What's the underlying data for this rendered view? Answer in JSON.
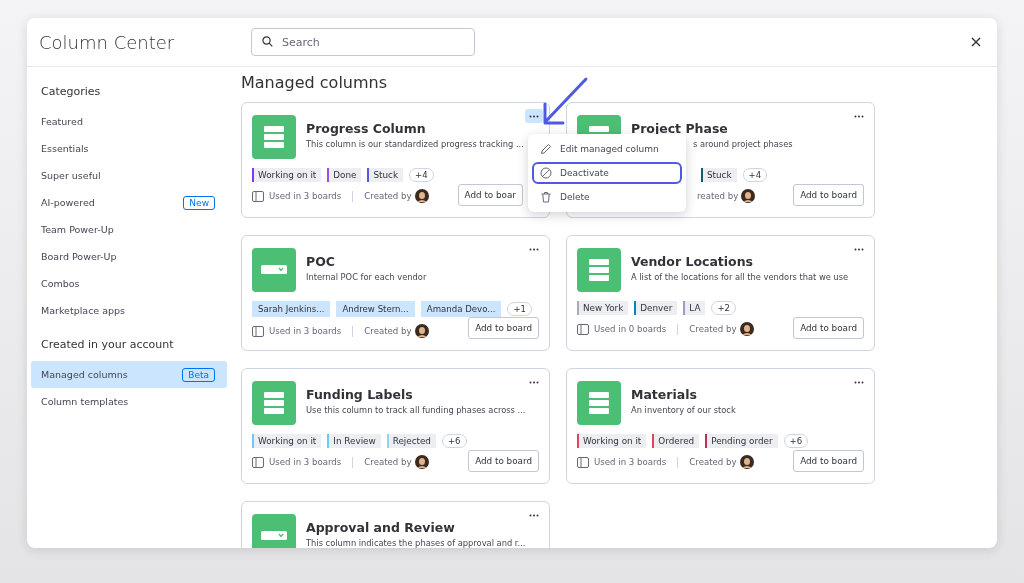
{
  "window": {
    "title": "Column Center"
  },
  "search": {
    "placeholder": "Search"
  },
  "sidebar": {
    "sections": [
      {
        "heading": "Categories",
        "items": [
          {
            "label": "Featured",
            "selected": false
          },
          {
            "label": "Essentials",
            "selected": false
          },
          {
            "label": "Super useful",
            "selected": false
          },
          {
            "label": "AI-powered",
            "badge": "New",
            "selected": false
          },
          {
            "label": "Team Power-Up",
            "selected": false
          },
          {
            "label": "Board Power-Up",
            "selected": false
          },
          {
            "label": "Combos",
            "selected": false
          },
          {
            "label": "Marketplace apps",
            "selected": false
          }
        ]
      },
      {
        "heading": "Created in your account",
        "items": [
          {
            "label": "Managed columns",
            "badge": "Beta",
            "selected": true
          },
          {
            "label": "Column templates",
            "selected": false
          }
        ]
      }
    ]
  },
  "main": {
    "heading": "Managed columns",
    "cards": [
      {
        "kind": "status",
        "title": "Progress Column",
        "description": "This column is our standardized progress tracking ...",
        "tags": [
          {
            "label": "Working on it",
            "color": "#7e3af2"
          },
          {
            "label": "Done",
            "color": "#9d50dd"
          },
          {
            "label": "Stuck",
            "color": "#5559df"
          }
        ],
        "more": "+4",
        "used": "Used in 3 boards",
        "created": "Created by",
        "add": "Add to boar",
        "menu_open": true
      },
      {
        "kind": "status",
        "title": "Project Phase",
        "description": "s around project phases",
        "tags": [
          {
            "label": "Stuck",
            "color": "#175a63"
          }
        ],
        "more": "+4",
        "created": "reated by",
        "add": "Add to board",
        "menu_open": false
      },
      {
        "kind": "dropdown",
        "title": "POC",
        "description": "Internal POC for each vendor",
        "tags": [
          {
            "label": "Sarah Jenkins..."
          },
          {
            "label": "Andrew Stern..."
          },
          {
            "label": "Amanda Devo..."
          }
        ],
        "more": "+1",
        "used": "Used in 3 boards",
        "created": "Created by",
        "add": "Add to board",
        "menu_open": false
      },
      {
        "kind": "status",
        "title": "Vendor Locations",
        "description": "A list of the locations for all the vendors that we use",
        "tags": [
          {
            "label": "New York",
            "color": "#a9a9b8"
          },
          {
            "label": "Denver",
            "color": "#0086c0"
          },
          {
            "label": "LA",
            "color": "#9d99c8"
          }
        ],
        "more": "+2",
        "used": "Used in 0 boards",
        "created": "Created by",
        "add": "Add to board",
        "menu_open": false
      },
      {
        "kind": "status",
        "title": "Funding Labels",
        "description": "Use this column to track all funding phases across ...",
        "tags": [
          {
            "label": "Working on it",
            "color": "#66ccff"
          },
          {
            "label": "In Review",
            "color": "#66ccff"
          },
          {
            "label": "Rejected",
            "color": "#8fd3f5"
          }
        ],
        "more": "+6",
        "used": "Used in 3 boards",
        "created": "Created by",
        "add": "Add to board",
        "menu_open": false
      },
      {
        "kind": "status",
        "title": "Materials",
        "description": "An inventory of our stock",
        "tags": [
          {
            "label": "Working on it",
            "color": "#e2445c"
          },
          {
            "label": "Ordered",
            "color": "#e2445c"
          },
          {
            "label": "Pending order",
            "color": "#bb3354"
          }
        ],
        "more": "+6",
        "used": "Used in 3 boards",
        "created": "Created by",
        "add": "Add to board",
        "menu_open": false
      },
      {
        "kind": "dropdown",
        "title": "Approval and Review",
        "description": "This column indicates the phases of approval and r...",
        "menu_open": false
      }
    ],
    "menu": {
      "items": [
        {
          "label": "Edit managed column",
          "selected": false
        },
        {
          "label": "Deactivate",
          "selected": true
        },
        {
          "label": "Delete",
          "selected": false
        }
      ]
    }
  }
}
